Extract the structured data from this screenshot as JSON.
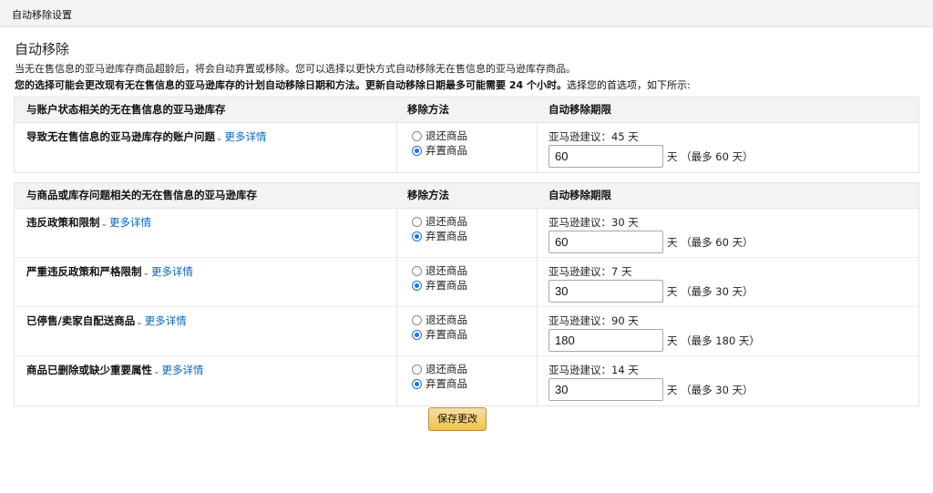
{
  "window": {
    "title": "自动移除设置"
  },
  "header": {
    "heading": "自动移除",
    "description": "当无在售信息的亚马逊库存商品超龄后，将会自动弃置或移除。您可以选择以更快方式自动移除无在售信息的亚马逊库存商品。",
    "notice_bold": "您的选择可能会更改现有无在售信息的亚马逊库存的计划自动移除日期和方法。更新自动移除日期最多可能需要 24 个小时。",
    "notice_tail": "选择您的首选项，如下所示:"
  },
  "account_table": {
    "headers": {
      "reason": "与账户状态相关的无在售信息的亚马逊库存",
      "method": "移除方法",
      "period": "自动移除期限"
    },
    "rows": [
      {
        "reason": "导致无在售信息的亚马逊库存的账户问题",
        "more": "更多详情",
        "option_return": "退还商品",
        "option_dispose": "弃置商品",
        "selected": "弃置商品",
        "suggestion": "亚马逊建议：45 天",
        "value": "60",
        "unit": "天 （最多 60 天）"
      }
    ]
  },
  "listing_table": {
    "headers": {
      "reason": "与商品或库存问题相关的无在售信息的亚马逊库存",
      "method": "移除方法",
      "period": "自动移除期限"
    },
    "rows": [
      {
        "reason": "违反政策和限制",
        "more": "更多详情",
        "option_return": "退还商品",
        "option_dispose": "弃置商品",
        "selected": "弃置商品",
        "suggestion": "亚马逊建议：30 天",
        "value": "60",
        "unit": "天 （最多 60 天）"
      },
      {
        "reason": "严重违反政策和严格限制",
        "more": "更多详情",
        "option_return": "退还商品",
        "option_dispose": "弃置商品",
        "selected": "弃置商品",
        "suggestion": "亚马逊建议：7 天",
        "value": "30",
        "unit": "天 （最多 30 天）"
      },
      {
        "reason": "已停售/卖家自配送商品",
        "more": "更多详情",
        "option_return": "退还商品",
        "option_dispose": "弃置商品",
        "selected": "弃置商品",
        "suggestion": "亚马逊建议：90 天",
        "value": "180",
        "unit": "天 （最多 180 天）"
      },
      {
        "reason": "商品已删除或缺少重要属性",
        "more": "更多详情",
        "option_return": "退还商品",
        "option_dispose": "弃置商品",
        "selected": "弃置商品",
        "suggestion": "亚马逊建议：14 天",
        "value": "30",
        "unit": "天 （最多 30 天）"
      }
    ]
  },
  "actions": {
    "save": "保存更改"
  },
  "icons": {
    "expand": "chevron-down-icon",
    "radio_selected_color": "#1a73e8",
    "link_color": "#0066c0"
  }
}
